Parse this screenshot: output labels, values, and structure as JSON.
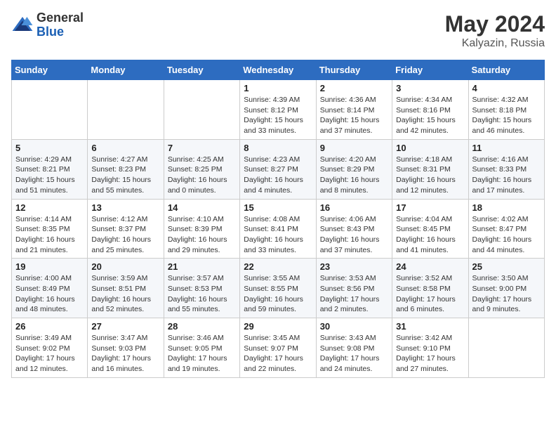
{
  "header": {
    "logo_general": "General",
    "logo_blue": "Blue",
    "month_year": "May 2024",
    "location": "Kalyazin, Russia"
  },
  "days_of_week": [
    "Sunday",
    "Monday",
    "Tuesday",
    "Wednesday",
    "Thursday",
    "Friday",
    "Saturday"
  ],
  "weeks": [
    [
      {
        "day": "",
        "info": ""
      },
      {
        "day": "",
        "info": ""
      },
      {
        "day": "",
        "info": ""
      },
      {
        "day": "1",
        "info": "Sunrise: 4:39 AM\nSunset: 8:12 PM\nDaylight: 15 hours\nand 33 minutes."
      },
      {
        "day": "2",
        "info": "Sunrise: 4:36 AM\nSunset: 8:14 PM\nDaylight: 15 hours\nand 37 minutes."
      },
      {
        "day": "3",
        "info": "Sunrise: 4:34 AM\nSunset: 8:16 PM\nDaylight: 15 hours\nand 42 minutes."
      },
      {
        "day": "4",
        "info": "Sunrise: 4:32 AM\nSunset: 8:18 PM\nDaylight: 15 hours\nand 46 minutes."
      }
    ],
    [
      {
        "day": "5",
        "info": "Sunrise: 4:29 AM\nSunset: 8:21 PM\nDaylight: 15 hours\nand 51 minutes."
      },
      {
        "day": "6",
        "info": "Sunrise: 4:27 AM\nSunset: 8:23 PM\nDaylight: 15 hours\nand 55 minutes."
      },
      {
        "day": "7",
        "info": "Sunrise: 4:25 AM\nSunset: 8:25 PM\nDaylight: 16 hours\nand 0 minutes."
      },
      {
        "day": "8",
        "info": "Sunrise: 4:23 AM\nSunset: 8:27 PM\nDaylight: 16 hours\nand 4 minutes."
      },
      {
        "day": "9",
        "info": "Sunrise: 4:20 AM\nSunset: 8:29 PM\nDaylight: 16 hours\nand 8 minutes."
      },
      {
        "day": "10",
        "info": "Sunrise: 4:18 AM\nSunset: 8:31 PM\nDaylight: 16 hours\nand 12 minutes."
      },
      {
        "day": "11",
        "info": "Sunrise: 4:16 AM\nSunset: 8:33 PM\nDaylight: 16 hours\nand 17 minutes."
      }
    ],
    [
      {
        "day": "12",
        "info": "Sunrise: 4:14 AM\nSunset: 8:35 PM\nDaylight: 16 hours\nand 21 minutes."
      },
      {
        "day": "13",
        "info": "Sunrise: 4:12 AM\nSunset: 8:37 PM\nDaylight: 16 hours\nand 25 minutes."
      },
      {
        "day": "14",
        "info": "Sunrise: 4:10 AM\nSunset: 8:39 PM\nDaylight: 16 hours\nand 29 minutes."
      },
      {
        "day": "15",
        "info": "Sunrise: 4:08 AM\nSunset: 8:41 PM\nDaylight: 16 hours\nand 33 minutes."
      },
      {
        "day": "16",
        "info": "Sunrise: 4:06 AM\nSunset: 8:43 PM\nDaylight: 16 hours\nand 37 minutes."
      },
      {
        "day": "17",
        "info": "Sunrise: 4:04 AM\nSunset: 8:45 PM\nDaylight: 16 hours\nand 41 minutes."
      },
      {
        "day": "18",
        "info": "Sunrise: 4:02 AM\nSunset: 8:47 PM\nDaylight: 16 hours\nand 44 minutes."
      }
    ],
    [
      {
        "day": "19",
        "info": "Sunrise: 4:00 AM\nSunset: 8:49 PM\nDaylight: 16 hours\nand 48 minutes."
      },
      {
        "day": "20",
        "info": "Sunrise: 3:59 AM\nSunset: 8:51 PM\nDaylight: 16 hours\nand 52 minutes."
      },
      {
        "day": "21",
        "info": "Sunrise: 3:57 AM\nSunset: 8:53 PM\nDaylight: 16 hours\nand 55 minutes."
      },
      {
        "day": "22",
        "info": "Sunrise: 3:55 AM\nSunset: 8:55 PM\nDaylight: 16 hours\nand 59 minutes."
      },
      {
        "day": "23",
        "info": "Sunrise: 3:53 AM\nSunset: 8:56 PM\nDaylight: 17 hours\nand 2 minutes."
      },
      {
        "day": "24",
        "info": "Sunrise: 3:52 AM\nSunset: 8:58 PM\nDaylight: 17 hours\nand 6 minutes."
      },
      {
        "day": "25",
        "info": "Sunrise: 3:50 AM\nSunset: 9:00 PM\nDaylight: 17 hours\nand 9 minutes."
      }
    ],
    [
      {
        "day": "26",
        "info": "Sunrise: 3:49 AM\nSunset: 9:02 PM\nDaylight: 17 hours\nand 12 minutes."
      },
      {
        "day": "27",
        "info": "Sunrise: 3:47 AM\nSunset: 9:03 PM\nDaylight: 17 hours\nand 16 minutes."
      },
      {
        "day": "28",
        "info": "Sunrise: 3:46 AM\nSunset: 9:05 PM\nDaylight: 17 hours\nand 19 minutes."
      },
      {
        "day": "29",
        "info": "Sunrise: 3:45 AM\nSunset: 9:07 PM\nDaylight: 17 hours\nand 22 minutes."
      },
      {
        "day": "30",
        "info": "Sunrise: 3:43 AM\nSunset: 9:08 PM\nDaylight: 17 hours\nand 24 minutes."
      },
      {
        "day": "31",
        "info": "Sunrise: 3:42 AM\nSunset: 9:10 PM\nDaylight: 17 hours\nand 27 minutes."
      },
      {
        "day": "",
        "info": ""
      }
    ]
  ]
}
